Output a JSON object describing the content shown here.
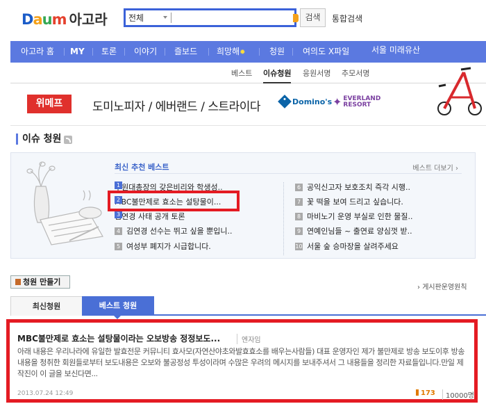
{
  "header": {
    "logo_letters": [
      "D",
      "a",
      "u",
      "m"
    ],
    "logo_service": "아고라",
    "search_scope": "전체",
    "search_value": "",
    "search_button": "검색",
    "total_search": "통합검색"
  },
  "nav": {
    "items": [
      "아고라 홈",
      "MY",
      "토론",
      "이야기",
      "즐보드",
      "희망해",
      "청원",
      "여의도 X파일"
    ],
    "extra": "서울 미래유산"
  },
  "subnav": {
    "items": [
      "베스트",
      "이슈청원",
      "응원서명",
      "추모서명"
    ],
    "active": "이슈청원"
  },
  "ad": {
    "brand": "위메프",
    "text": "도미노피자 / 에버랜드 / 스트라이다",
    "dominos": "Domino's",
    "everland": [
      "EVERLAND",
      "RESORT"
    ]
  },
  "issue": {
    "title": "이슈 청원",
    "best_label": "최신 추천 베스트",
    "best_more": "베스트 더보기",
    "left": [
      {
        "num": "1",
        "title": "수원대총장의 갖은비리와 학생성.."
      },
      {
        "num": "2",
        "title": "MBC불만제로 효소는 설탕물이..."
      },
      {
        "num": "3",
        "title": "김연경 사태 공개 토론"
      },
      {
        "num": "4",
        "title": "김연경 선수는 뛰고 싶을 뿐입니.."
      },
      {
        "num": "5",
        "title": "여성부 폐지가 시급합니다."
      }
    ],
    "right": [
      {
        "num": "6",
        "title": "공익신고자 보호조치 즉각 시행.."
      },
      {
        "num": "7",
        "title": "꽃 떡을 보여 드리고 싶습니다."
      },
      {
        "num": "8",
        "title": "마비노기 운영 부실로 인한 물질.."
      },
      {
        "num": "9",
        "title": "연예인님들 ~ 출연료 양심껏 받.."
      },
      {
        "num": "10",
        "title": "서울 숲 승마장을 살려주세요"
      }
    ]
  },
  "actions": {
    "make_petition": "청원 만들기",
    "rules": "게시판운영원칙"
  },
  "tabs": [
    "최신청원",
    "베스트 청원"
  ],
  "post": {
    "title": "MBC불만제로 효소는 설탕물이라는 오보방송 정정보도...",
    "author": "엔자임",
    "body": "아래 내용은 우리나라에 유일한 발효전문 커뮤니티 효사모(자연산야초와발효효소를 배우는사람들) 대표 운영자인 제가 불만제로 방송 보도이후 방송내용을 청취한 회원들로부터 보도내용은 오보와 불공정성 투성이라며 수많은 우려의 메시지를 보내주셔서 그 내용들을 정리한 자료들입니다.만일 제작진이 이 글을 보신다면...",
    "date": "2013.07.24 12:49",
    "count": "173",
    "goal": "10000명"
  }
}
